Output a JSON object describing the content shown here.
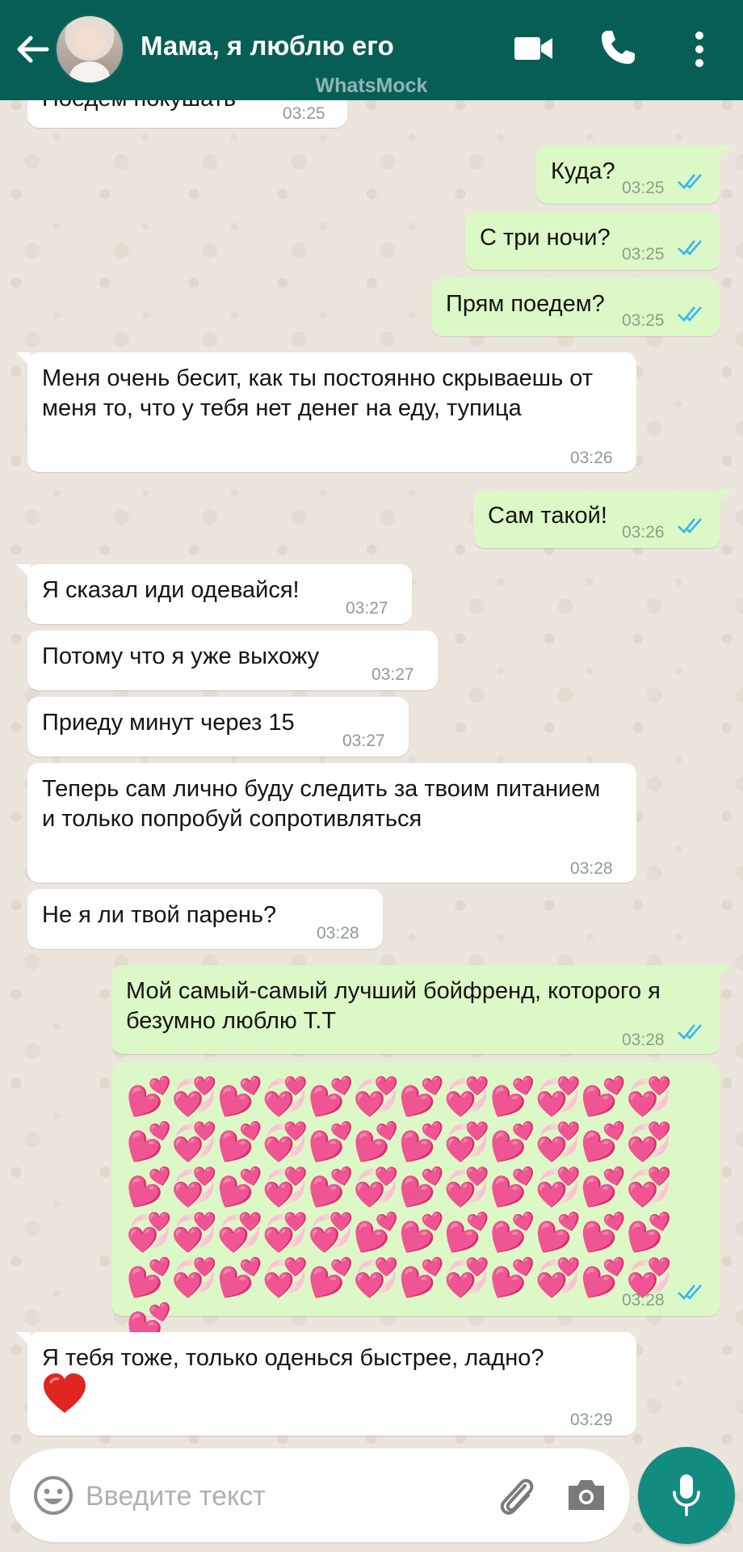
{
  "app": {
    "watermark": "WhatsMock",
    "accent": "#075e54",
    "bubble_out": "#dcf8c6",
    "bubble_in": "#ffffff"
  },
  "header": {
    "title": "Мама, я люблю его"
  },
  "messages": [
    {
      "dir": "in",
      "text": "Поедем покушать",
      "time": "03:25"
    },
    {
      "dir": "out",
      "text": "Куда?",
      "time": "03:25",
      "status": "read"
    },
    {
      "dir": "out",
      "text": "С три ночи?",
      "time": "03:25",
      "status": "read"
    },
    {
      "dir": "out",
      "text": "Прям поедем?",
      "time": "03:25",
      "status": "read"
    },
    {
      "dir": "in",
      "text": "Меня очень бесит, как ты постоянно скрываешь от меня то, что у тебя нет денег на еду, тупица",
      "time": "03:26"
    },
    {
      "dir": "out",
      "text": "Сам такой!",
      "time": "03:26",
      "status": "read"
    },
    {
      "dir": "in",
      "text": "Я сказал иди одевайся!",
      "time": "03:27"
    },
    {
      "dir": "in",
      "text": "Потому что я уже выхожу",
      "time": "03:27"
    },
    {
      "dir": "in",
      "text": "Приеду минут через 15",
      "time": "03:27"
    },
    {
      "dir": "in",
      "text": "Теперь сам лично буду следить за твоим питанием и только попробуй сопротивляться",
      "time": "03:28"
    },
    {
      "dir": "in",
      "text": "Не я ли твой парень?",
      "time": "03:28"
    },
    {
      "dir": "out",
      "text": "Мой самый-самый лучший бойфренд, которого я безумно люблю Т.Т",
      "time": "03:28",
      "status": "read"
    },
    {
      "dir": "out",
      "text": "💕💞💕💞💕💞💕💞💕💞💕💞💕💞💕💞💕💕💕💞💕💞💕💞💕💞💕💞💕💞💕💞💕💞💕💞💞💞💞💞💞💕💕💕💕💕💕💕💕💞💕💞💕💞💕💞💕💞💕💞💕",
      "time": "03:28",
      "status": "read"
    },
    {
      "dir": "in",
      "text": "Я тебя тоже, только оденься быстрее, ладно?",
      "emoji": "heart",
      "time": "03:29"
    }
  ],
  "composer": {
    "placeholder": "Введите текст"
  }
}
